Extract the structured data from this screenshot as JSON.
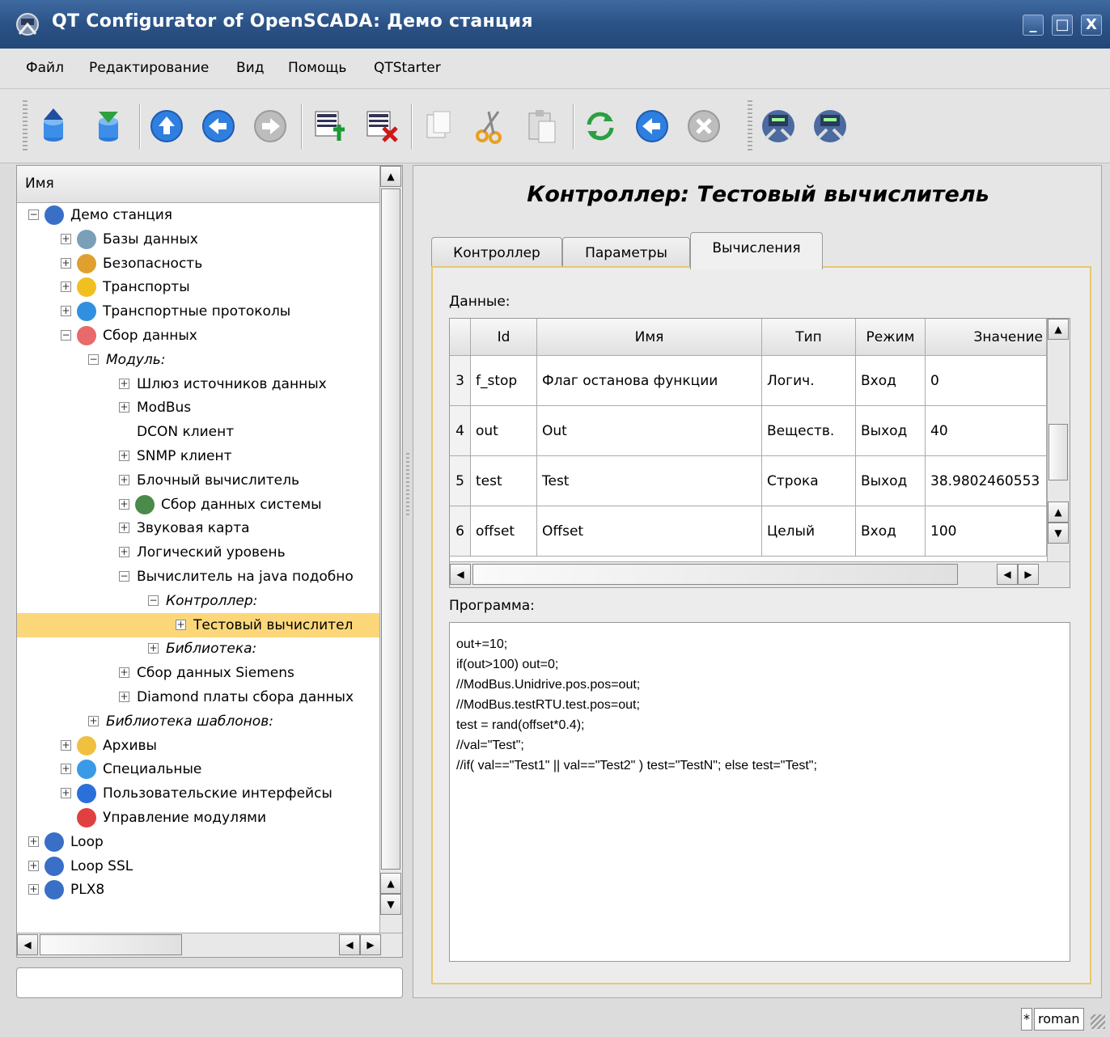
{
  "window": {
    "title": "QT Configurator of OpenSCADA: Демо станция",
    "buttons": [
      "_",
      "□",
      "X"
    ]
  },
  "menu": [
    "Файл",
    "Редактирование",
    "Вид",
    "Помощь",
    "QTStarter"
  ],
  "toolbar": {
    "icons": [
      "db-load-icon",
      "db-save-icon",
      "up-icon",
      "back-icon",
      "forward-icon",
      "add-item-icon",
      "delete-item-icon",
      "copy-icon",
      "cut-icon",
      "paste-icon",
      "refresh-icon",
      "start-icon",
      "stop-icon",
      "station-icon",
      "station-icon-2"
    ]
  },
  "tree": {
    "header": "Имя",
    "items": [
      {
        "label": "Демо станция",
        "italic": false
      },
      {
        "label": "Базы данных",
        "italic": false
      },
      {
        "label": "Безопасность",
        "italic": false
      },
      {
        "label": "Транспорты",
        "italic": false
      },
      {
        "label": "Транспортные протоколы",
        "italic": false
      },
      {
        "label": "Сбор данных",
        "italic": false
      },
      {
        "label": "Модуль:",
        "italic": true
      },
      {
        "label": "Шлюз источников данных",
        "italic": false
      },
      {
        "label": "ModBus",
        "italic": false
      },
      {
        "label": "DCON клиент",
        "italic": false
      },
      {
        "label": "SNMP клиент",
        "italic": false
      },
      {
        "label": "Блочный вычислитель",
        "italic": false
      },
      {
        "label": "Сбор данных системы",
        "italic": false
      },
      {
        "label": "Звуковая карта",
        "italic": false
      },
      {
        "label": "Логический уровень",
        "italic": false
      },
      {
        "label": "Вычислитель на java подобно",
        "italic": false
      },
      {
        "label": "Контроллер:",
        "italic": true
      },
      {
        "label": "Тестовый вычислител",
        "italic": false
      },
      {
        "label": "Библиотека:",
        "italic": true
      },
      {
        "label": "Сбор данных Siemens",
        "italic": false
      },
      {
        "label": "Diamond платы сбора данных",
        "italic": false
      },
      {
        "label": "Библиотека шаблонов:",
        "italic": true
      },
      {
        "label": "Архивы",
        "italic": false
      },
      {
        "label": "Специальные",
        "italic": false
      },
      {
        "label": "Пользовательские интерфейсы",
        "italic": false
      },
      {
        "label": "Управление модулями",
        "italic": false
      },
      {
        "label": "Loop",
        "italic": false
      },
      {
        "label": "Loop SSL",
        "italic": false
      },
      {
        "label": "PLX8",
        "italic": false
      }
    ]
  },
  "page": {
    "title": "Контроллер: Тестовый вычислитель",
    "tabs": [
      "Контроллер",
      "Параметры",
      "Вычисления"
    ],
    "active_tab": "Вычисления",
    "data_label": "Данные:",
    "program_label": "Программа:"
  },
  "grid": {
    "columns": [
      "Id",
      "Имя",
      "Тип",
      "Режим",
      "Значение"
    ],
    "rows": [
      {
        "n": "3",
        "id": "f_stop",
        "name": "Флаг останова функции",
        "type": "Логич.",
        "mode": "Вход",
        "value": "0"
      },
      {
        "n": "4",
        "id": "out",
        "name": "Out",
        "type": "Веществ.",
        "mode": "Выход",
        "value": "40"
      },
      {
        "n": "5",
        "id": "test",
        "name": "Test",
        "type": "Строка",
        "mode": "Выход",
        "value": "38.9802460553"
      },
      {
        "n": "6",
        "id": "offset",
        "name": "Offset",
        "type": "Целый",
        "mode": "Вход",
        "value": "100"
      }
    ]
  },
  "program": [
    "out+=10;",
    "if(out>100) out=0;",
    "//ModBus.Unidrive.pos.pos=out;",
    "//ModBus.testRTU.test.pos=out;",
    "test = rand(offset*0.4);",
    "//val=\"Test\";",
    "//if( val==\"Test1\" || val==\"Test2\" ) test=\"TestN\"; else test=\"Test\";"
  ],
  "status": {
    "modified": "*",
    "user": "roman"
  }
}
